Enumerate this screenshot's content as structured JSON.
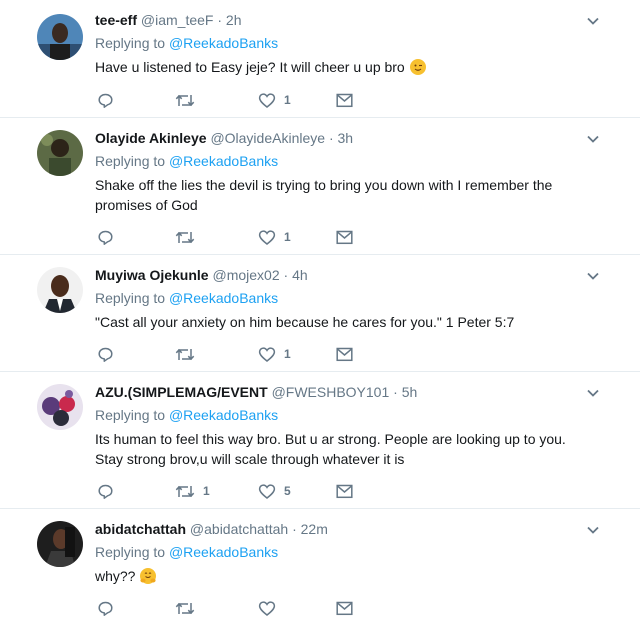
{
  "replying_prefix": "Replying to",
  "replies": [
    {
      "name": "tee-eff",
      "handle": "@iam_teeF",
      "time": "· 2h",
      "replying_to": "@ReekadoBanks",
      "text": "Have u listened to Easy jeje?   It will cheer u up bro",
      "emoji": "winking-face-emoji",
      "retweets": "",
      "likes": "1",
      "avatar_color": "#3b6e9e"
    },
    {
      "name": "Olayide Akinleye",
      "handle": "@OlayideAkinleye",
      "time": "· 3h",
      "replying_to": "@ReekadoBanks",
      "text": "Shake off the lies the devil is trying to bring you down with I remember the promises of God",
      "retweets": "",
      "likes": "1",
      "avatar_color": "#4a5a3a"
    },
    {
      "name": "Muyiwa Ojekunle",
      "handle": "@mojex02",
      "time": "· 4h",
      "replying_to": "@ReekadoBanks",
      "text": "\"Cast all your anxiety on him because he cares for you.\" 1 Peter 5:7",
      "retweets": "",
      "likes": "1",
      "avatar_color": "#f2f2f2"
    },
    {
      "name": "AZU.(SIMPLEMAG/EVENT",
      "handle": "@FWESHBOY101",
      "time": "· 5h",
      "replying_to": "@ReekadoBanks",
      "text": "Its human to feel this way bro. But u ar strong. People are looking up to you. Stay strong brov,u will scale through whatever it is",
      "retweets": "1",
      "likes": "5",
      "avatar_color": "#5a4a7a"
    },
    {
      "name": "abidatchattah",
      "handle": "@abidatchattah",
      "time": "· 22m",
      "replying_to": "@ReekadoBanks",
      "text": "why??",
      "emoji": "hugging-face-emoji",
      "retweets": "",
      "likes": "",
      "avatar_color": "#2a2a2a"
    }
  ]
}
